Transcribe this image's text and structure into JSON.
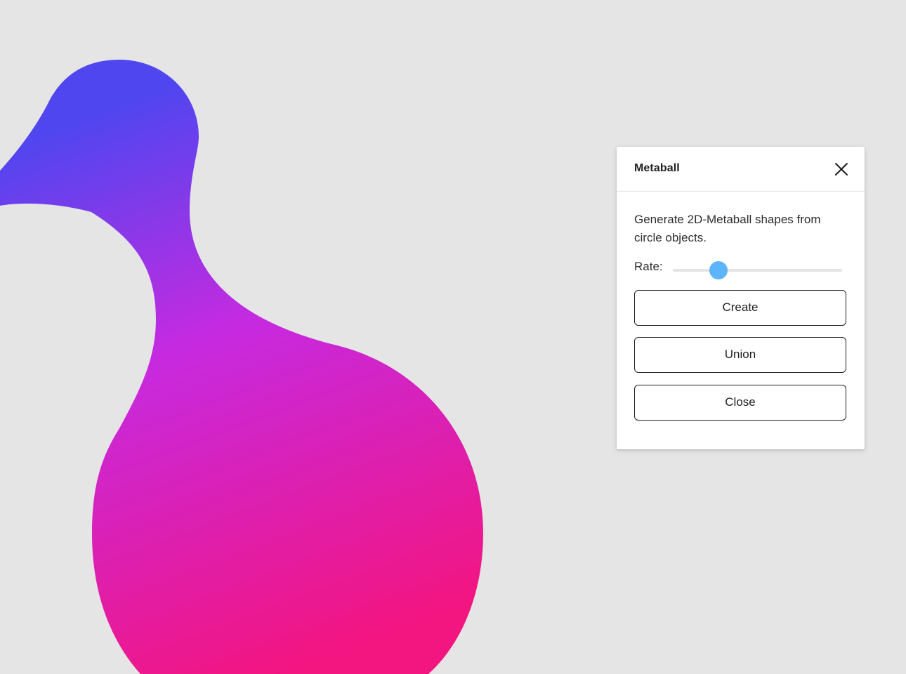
{
  "panel": {
    "title": "Metaball",
    "description": "Generate 2D-Metaball shapes from circle objects.",
    "rate": {
      "label": "Rate:",
      "value": 0.27
    },
    "buttons": {
      "create": "Create",
      "union": "Union",
      "close": "Close"
    }
  },
  "canvas": {
    "background": "#e5e5e5",
    "shape": "metaball-blob",
    "gradient_colors": [
      "#4f46f0",
      "#c62ae0",
      "#f31580"
    ]
  },
  "colors": {
    "slider_thumb": "#5cb4fb",
    "slider_track": "#e4e4e4",
    "button_border": "#1e1e1e"
  },
  "icons": {
    "close": "close-icon"
  }
}
